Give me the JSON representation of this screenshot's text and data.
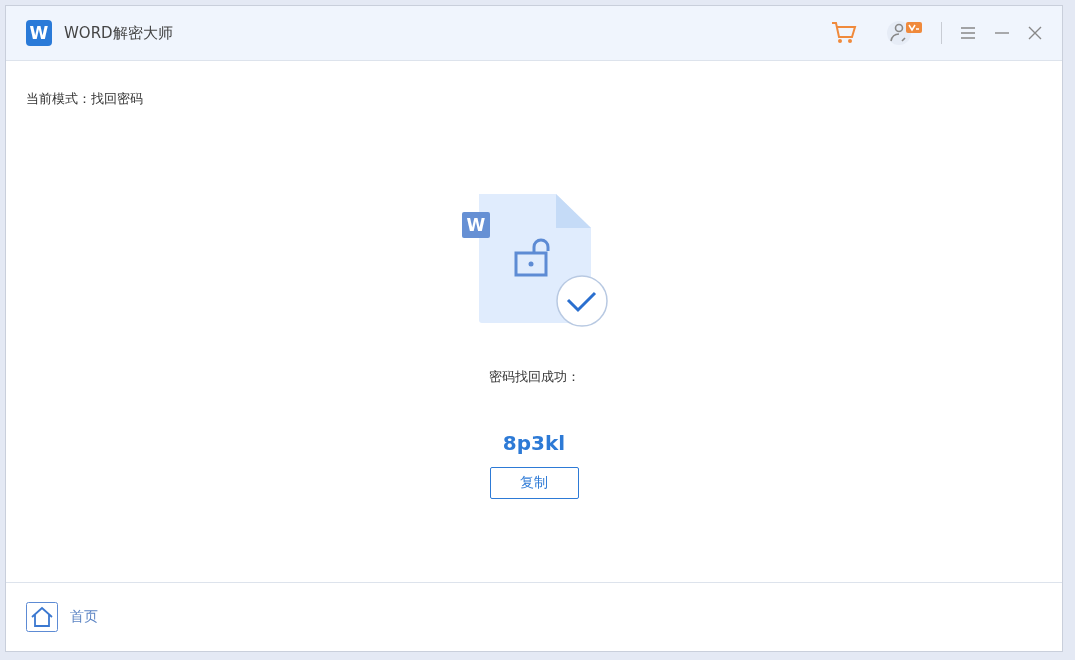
{
  "window": {
    "logo": "W",
    "title": "WORD解密大师"
  },
  "mode_label": "当前模式：找回密码",
  "file_badge": "W",
  "result": {
    "message": "密码找回成功：",
    "password": "8p3kl",
    "copy_button": "复制"
  },
  "footer": {
    "home_label": "首页"
  }
}
